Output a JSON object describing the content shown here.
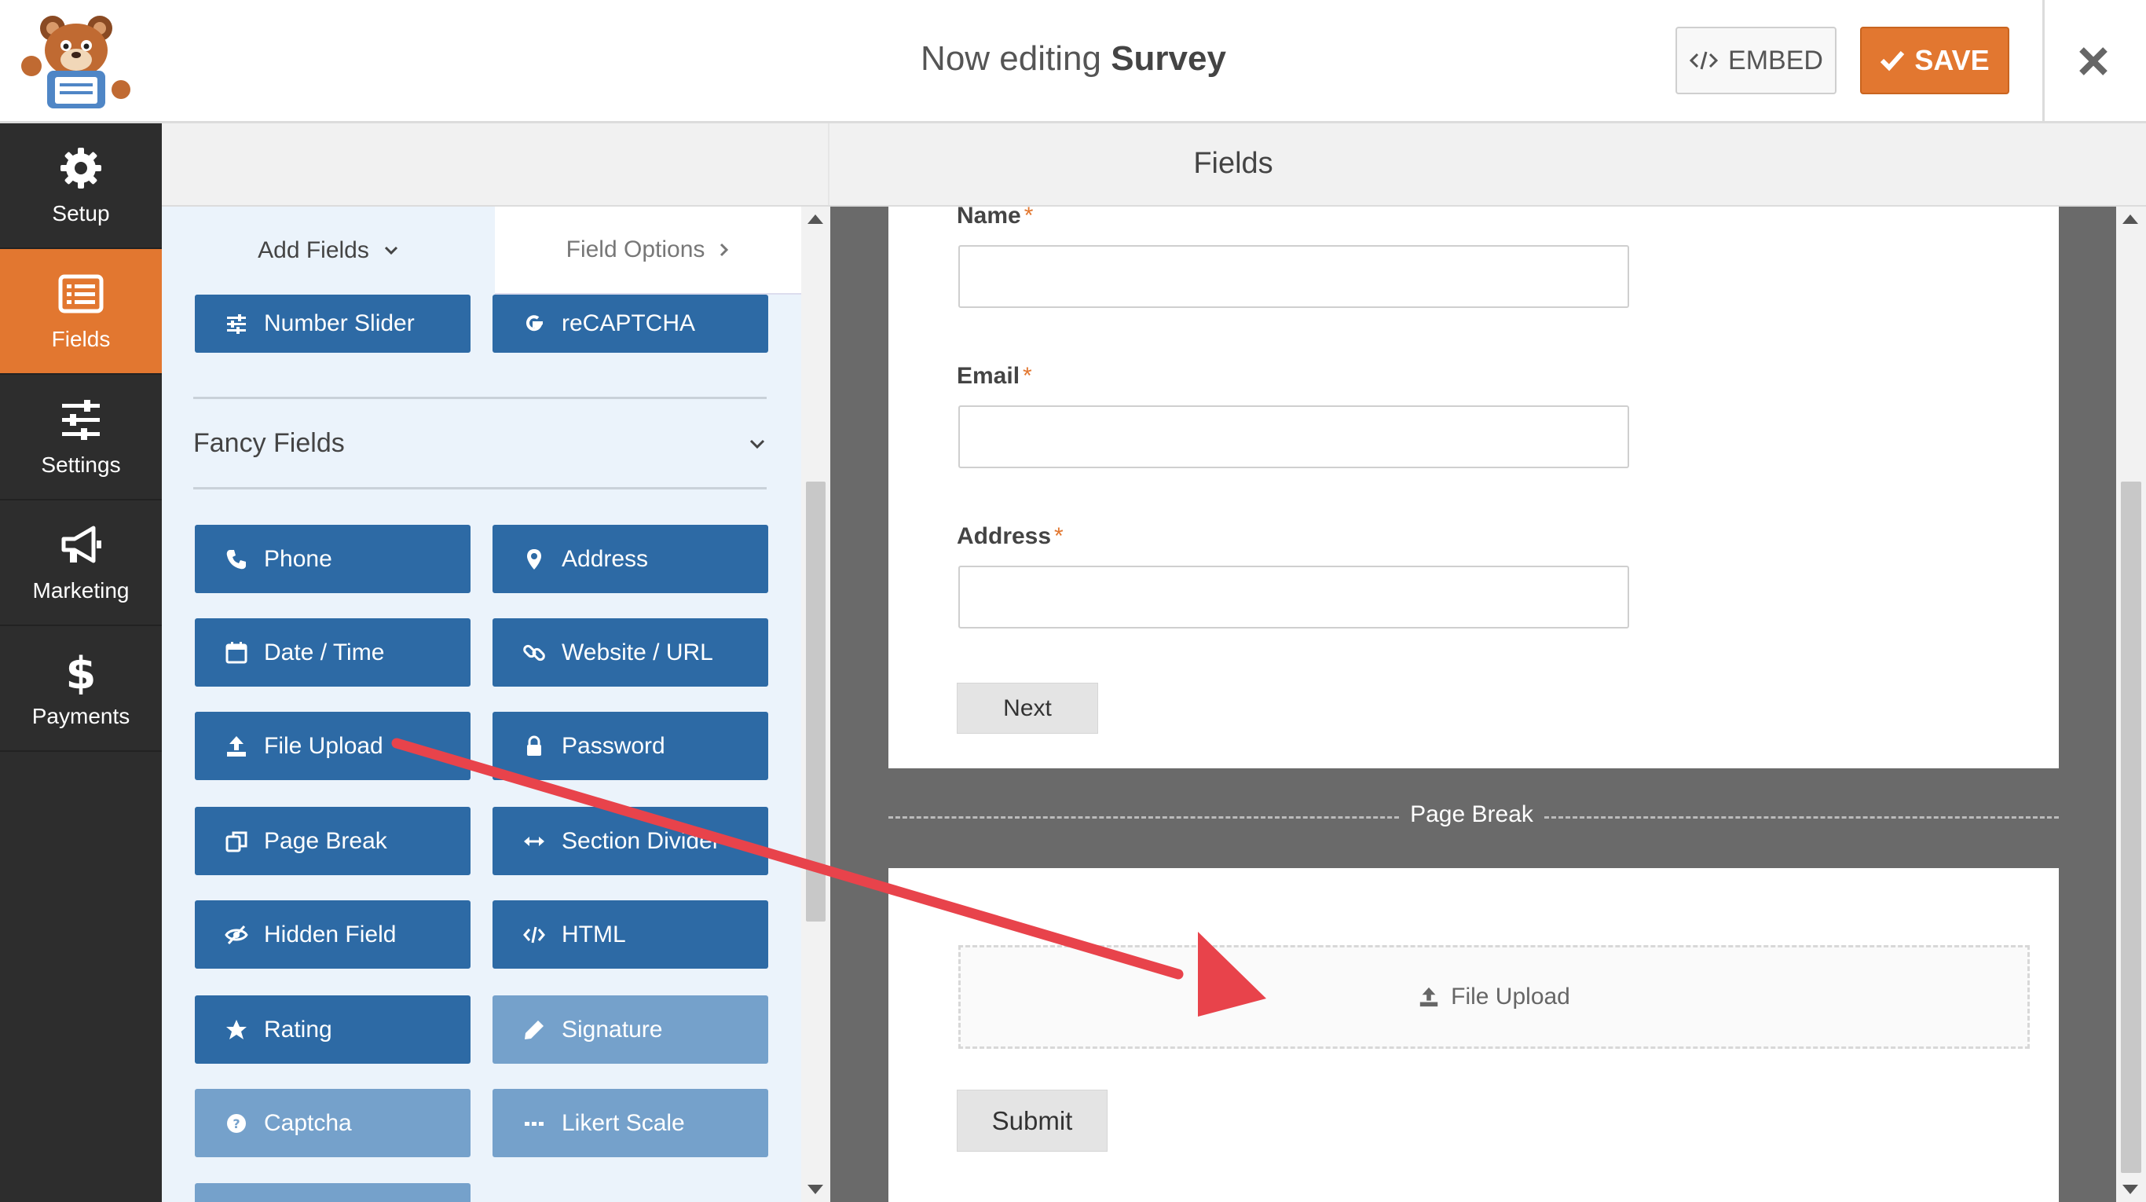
{
  "header": {
    "title_prefix": "Now editing",
    "form_name": "Survey",
    "embed_label": "EMBED",
    "save_label": "SAVE"
  },
  "nav": {
    "items": [
      {
        "label": "Setup",
        "icon": "gear-icon"
      },
      {
        "label": "Fields",
        "icon": "fields-list-icon",
        "active": true
      },
      {
        "label": "Settings",
        "icon": "sliders-icon"
      },
      {
        "label": "Marketing",
        "icon": "megaphone-icon"
      },
      {
        "label": "Payments",
        "icon": "dollar-icon"
      }
    ]
  },
  "section_header": "Fields",
  "panel": {
    "tabs": {
      "add_fields": "Add Fields",
      "field_options": "Field Options"
    },
    "top_buttons": [
      {
        "label": "Number Slider",
        "icon": "sliders-icon"
      },
      {
        "label": "reCAPTCHA",
        "icon": "google-icon"
      }
    ],
    "fancy_title": "Fancy Fields",
    "fancy_buttons": [
      {
        "label": "Phone",
        "icon": "phone-icon",
        "enabled": true
      },
      {
        "label": "Address",
        "icon": "map-marker-icon",
        "enabled": true
      },
      {
        "label": "Date / Time",
        "icon": "calendar-icon",
        "enabled": true
      },
      {
        "label": "Website / URL",
        "icon": "link-icon",
        "enabled": true
      },
      {
        "label": "File Upload",
        "icon": "upload-icon",
        "enabled": true
      },
      {
        "label": "Password",
        "icon": "lock-icon",
        "enabled": true
      },
      {
        "label": "Page Break",
        "icon": "copy-icon",
        "enabled": true
      },
      {
        "label": "Section Divider",
        "icon": "arrows-h-icon",
        "enabled": true
      },
      {
        "label": "Hidden Field",
        "icon": "eye-slash-icon",
        "enabled": true
      },
      {
        "label": "HTML",
        "icon": "code-icon",
        "enabled": true
      },
      {
        "label": "Rating",
        "icon": "star-icon",
        "enabled": true
      },
      {
        "label": "Signature",
        "icon": "pencil-icon",
        "enabled": false
      },
      {
        "label": "Captcha",
        "icon": "question-circle-icon",
        "enabled": false
      },
      {
        "label": "Likert Scale",
        "icon": "ellipsis-icon",
        "enabled": false
      }
    ]
  },
  "form": {
    "fields": [
      {
        "label": "Name",
        "required_mark": "*"
      },
      {
        "label": "Email",
        "required_mark": "*"
      },
      {
        "label": "Address",
        "required_mark": "*"
      }
    ],
    "next_label": "Next",
    "page_break_label": "Page Break",
    "upload_placeholder": "File Upload",
    "submit_label": "Submit"
  },
  "colors": {
    "accent": "#e27730",
    "field_button": "#2d6aa5",
    "field_button_disabled": "#75a1cb",
    "nav_bg": "#2d2d2d",
    "annotation_arrow": "#e8434b"
  }
}
